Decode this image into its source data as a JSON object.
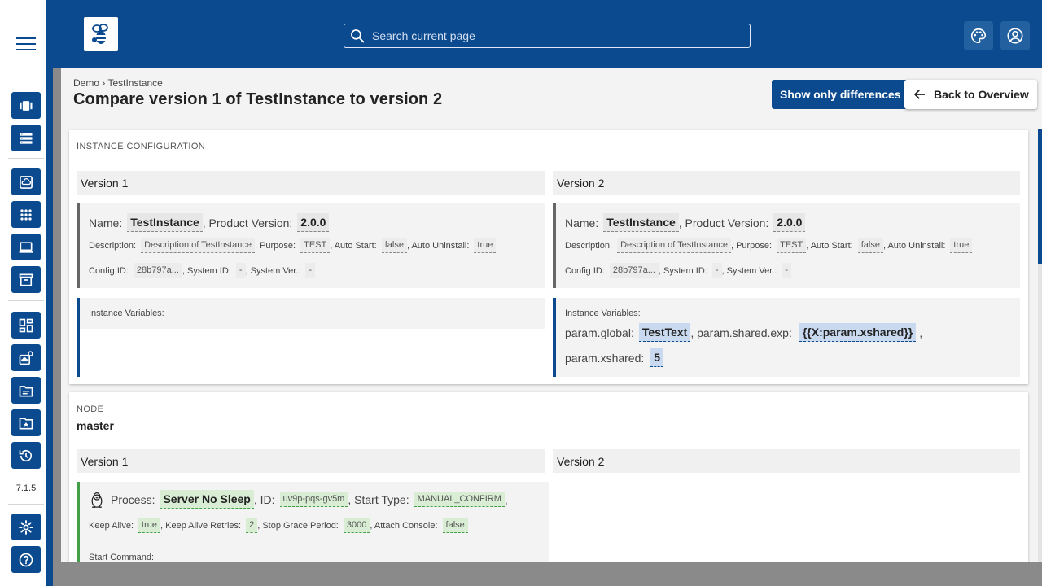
{
  "app": {
    "version": "7.1.5",
    "accent_color": "#0b4a8f"
  },
  "search": {
    "placeholder": "Search current page"
  },
  "header": {
    "breadcrumb": "Demo › TestInstance",
    "title": "Compare version 1 of TestInstance to version 2",
    "show_diff_label": "Show only differences",
    "back_label": "Back to Overview"
  },
  "instance_section": {
    "label": "INSTANCE CONFIGURATION",
    "v1": {
      "heading": "Version 1",
      "name_label": "Name:",
      "name": "TestInstance",
      "product_version_label": ", Product Version:",
      "product_version": "2.0.0",
      "description_label": "Description:",
      "description": "Description of TestInstance",
      "purpose_label": ", Purpose:",
      "purpose": "TEST",
      "auto_start_label": ", Auto Start:",
      "auto_start": "false",
      "auto_uninstall_label": ", Auto Uninstall:",
      "auto_uninstall": "true",
      "config_id_label": "Config ID:",
      "config_id": "28b797a...",
      "system_id_label": ", System ID:",
      "system_id": "-",
      "system_ver_label": ", System Ver.:",
      "system_ver": "-",
      "vars_label": "Instance Variables:"
    },
    "v2": {
      "heading": "Version 2",
      "name_label": "Name:",
      "name": "TestInstance",
      "product_version_label": ", Product Version:",
      "product_version": "2.0.0",
      "description_label": "Description:",
      "description": "Description of TestInstance",
      "purpose_label": ", Purpose:",
      "purpose": "TEST",
      "auto_start_label": ", Auto Start:",
      "auto_start": "false",
      "auto_uninstall_label": ", Auto Uninstall:",
      "auto_uninstall": "true",
      "config_id_label": "Config ID:",
      "config_id": "28b797a...",
      "system_id_label": ", System ID:",
      "system_id": "-",
      "system_ver_label": ", System Ver.:",
      "system_ver": "-",
      "vars_label": "Instance Variables:",
      "var1_label": "param.global:",
      "var1": "TestText",
      "var2_label": ", param.shared.exp:",
      "var2": "{{X:param.xshared}}",
      "var3_label": "param.xshared:",
      "var3": "5"
    }
  },
  "node_section": {
    "label": "NODE",
    "name": "master",
    "v1_heading": "Version 1",
    "v2_heading": "Version 2",
    "process": {
      "process_label": "Process:",
      "process_name": "Server No Sleep",
      "id_label": ", ID:",
      "id": "uv9p-pqs-gv5m",
      "start_type_label": ", Start Type:",
      "start_type": "MANUAL_CONFIRM",
      "keep_alive_label": "Keep Alive:",
      "keep_alive": "true",
      "retries_label": ", Keep Alive Retries:",
      "retries": "2",
      "grace_label": ", Stop Grace Period:",
      "grace": "3000",
      "attach_label": ", Attach Console:",
      "attach": "false",
      "start_command_label": "Start Command:"
    }
  },
  "rail": {
    "icons": [
      "dashboard-icon",
      "list-icon",
      "cloud-icon",
      "apps-icon",
      "laptop-icon",
      "archive-icon",
      "widgets-icon",
      "cloud-settings-icon",
      "description-icon",
      "folder-star-icon",
      "history-icon",
      "settings-icon",
      "help-icon"
    ]
  }
}
